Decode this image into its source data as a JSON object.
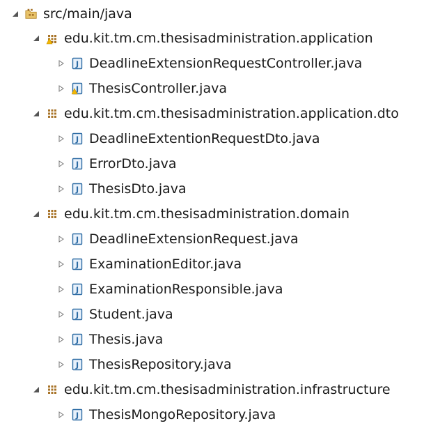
{
  "tree": {
    "source_folder": {
      "label": "src/main/java",
      "icon": "source-folder-icon",
      "expanded": true
    },
    "packages": [
      {
        "label": "edu.kit.tm.cm.thesisadministration.application",
        "icon": "package-warning-icon",
        "expanded": true,
        "files": [
          {
            "label": "DeadlineExtensionRequestController.java",
            "icon": "java-file-icon",
            "warning": false
          },
          {
            "label": "ThesisController.java",
            "icon": "java-file-warning-icon",
            "warning": true
          }
        ]
      },
      {
        "label": "edu.kit.tm.cm.thesisadministration.application.dto",
        "icon": "package-icon",
        "expanded": true,
        "files": [
          {
            "label": "DeadlineExtentionRequestDto.java",
            "icon": "java-file-icon",
            "warning": false
          },
          {
            "label": "ErrorDto.java",
            "icon": "java-file-icon",
            "warning": false
          },
          {
            "label": "ThesisDto.java",
            "icon": "java-file-icon",
            "warning": false
          }
        ]
      },
      {
        "label": "edu.kit.tm.cm.thesisadministration.domain",
        "icon": "package-icon",
        "expanded": true,
        "files": [
          {
            "label": "DeadlineExtensionRequest.java",
            "icon": "java-file-icon",
            "warning": false
          },
          {
            "label": "ExaminationEditor.java",
            "icon": "java-file-icon",
            "warning": false
          },
          {
            "label": "ExaminationResponsible.java",
            "icon": "java-file-icon",
            "warning": false
          },
          {
            "label": "Student.java",
            "icon": "java-file-icon",
            "warning": false
          },
          {
            "label": "Thesis.java",
            "icon": "java-file-icon",
            "warning": false
          },
          {
            "label": "ThesisRepository.java",
            "icon": "java-file-icon",
            "warning": false
          }
        ]
      },
      {
        "label": "edu.kit.tm.cm.thesisadministration.infrastructure",
        "icon": "package-icon",
        "expanded": true,
        "files": [
          {
            "label": "ThesisMongoRepository.java",
            "icon": "java-file-icon",
            "warning": false
          }
        ]
      }
    ]
  },
  "colors": {
    "text": "#1a1a1a",
    "twisty": "#555555",
    "package": "#a8742a",
    "java_file_border": "#2e6ca4",
    "java_file_fill": "#e8f1fb",
    "java_letter": "#2e6ca4",
    "warning": "#f2b705",
    "folder": "#d9a441"
  }
}
